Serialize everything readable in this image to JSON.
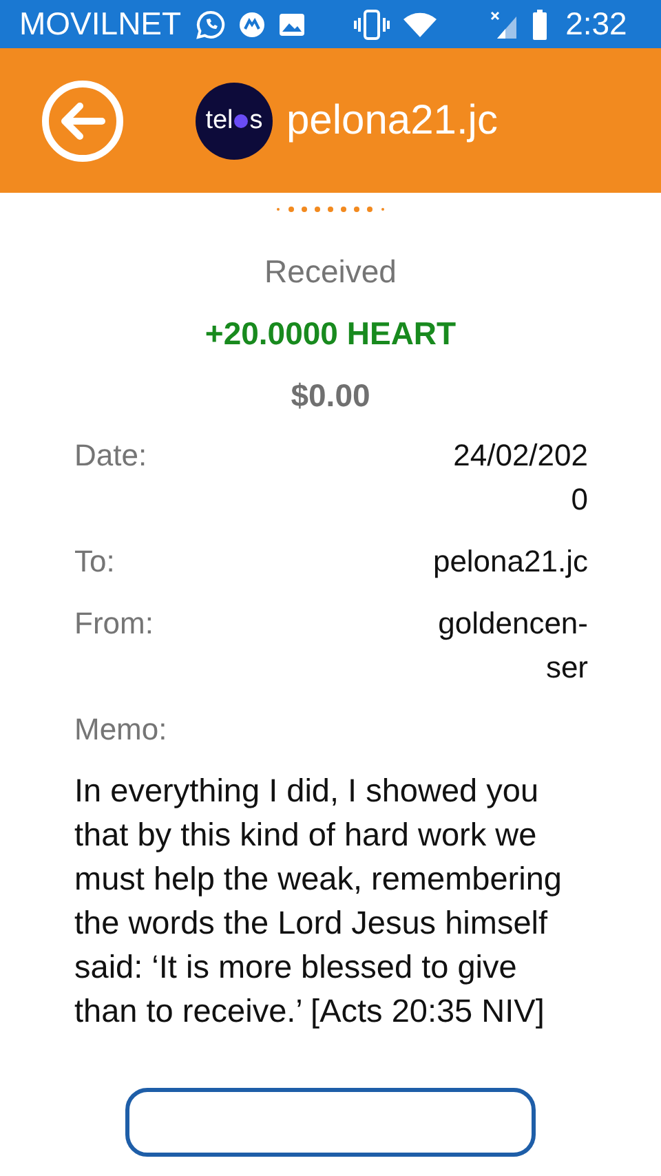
{
  "status_bar": {
    "carrier": "MOVILNET",
    "time": "2:32"
  },
  "header": {
    "logo": [
      "tel",
      "s"
    ],
    "title": "pelona21.jc"
  },
  "transaction": {
    "type": "Received",
    "amount": "+20.0000 HEART",
    "fiat": "$0.00"
  },
  "details": [
    {
      "label": "Date:",
      "value": "24/02/202\n0"
    },
    {
      "label": "To:",
      "value": "pelona21.jc"
    },
    {
      "label": "From:",
      "value": "goldencen-\nser"
    }
  ],
  "memo": {
    "label": "Memo:",
    "text": "In everything I did, I showed you that by this kind of hard work we must help the weak, remembering the words the Lord Jesus himself said: ‘It is more blessed to give than to receive.’ [Acts 20:35 NIV]"
  }
}
